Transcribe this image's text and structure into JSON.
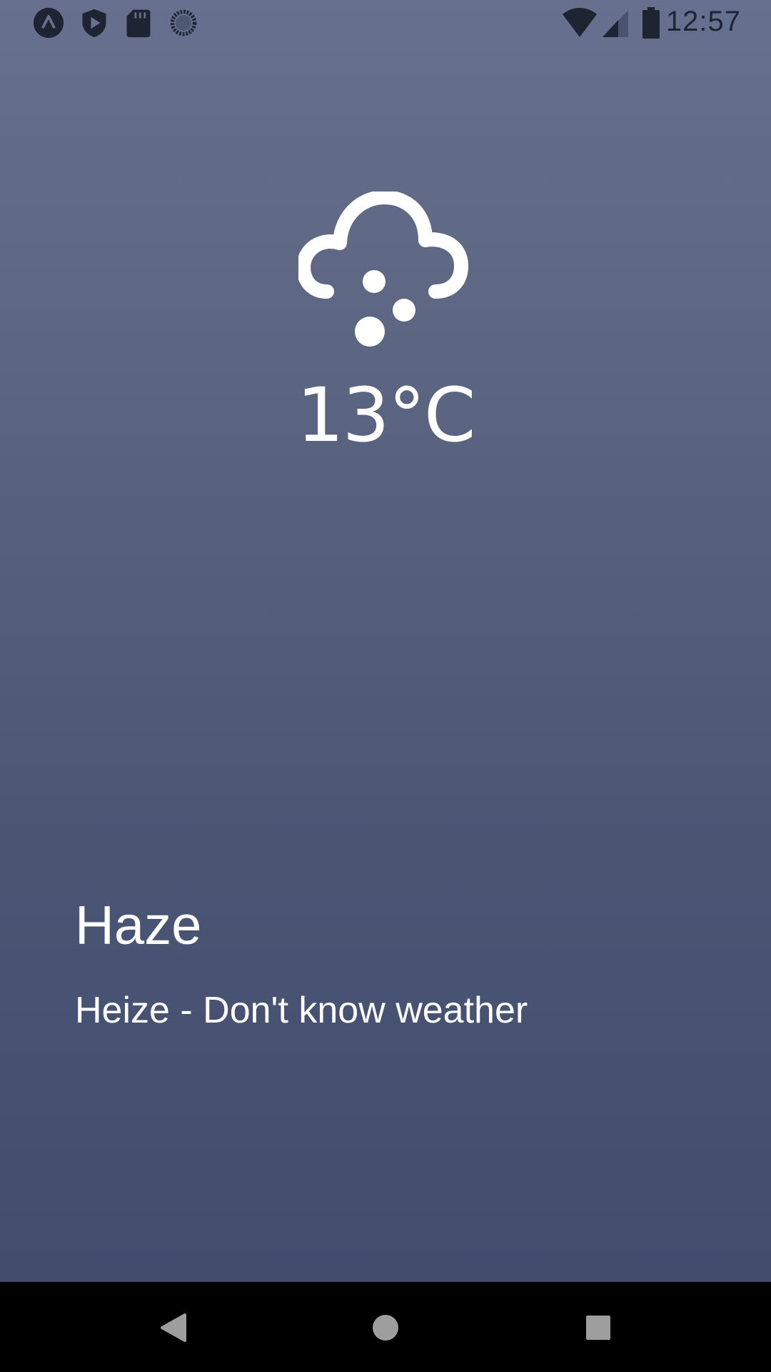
{
  "status_bar": {
    "time": "12:57",
    "left_icons": [
      "app-a-icon",
      "shield-play-icon",
      "sd-card-icon",
      "sync-icon"
    ],
    "right_icons": [
      "wifi-icon",
      "cell-signal-icon",
      "battery-icon"
    ]
  },
  "weather": {
    "icon": "cloud-hail-icon",
    "temperature": "13°C",
    "condition": "Haze",
    "description": "Heize - Don't know weather"
  },
  "nav_bar": {
    "buttons": [
      "back-icon",
      "home-icon",
      "recents-icon"
    ]
  },
  "colors": {
    "gradient_top": "#67718f",
    "gradient_bottom": "#424c6d",
    "text": "#ffffff",
    "status_icons": "#1f2433",
    "nav_background": "#000000",
    "nav_icons": "#9e9e9e"
  }
}
